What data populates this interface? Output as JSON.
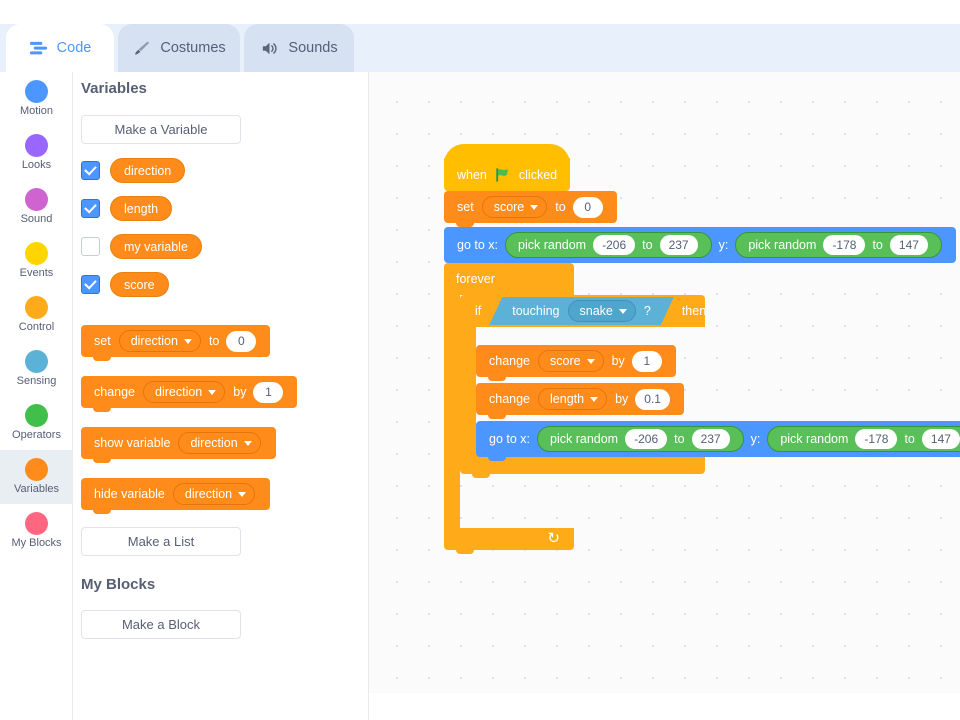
{
  "tabs": [
    {
      "id": "code",
      "label": "Code",
      "icon": "code-icon",
      "active": true
    },
    {
      "id": "costumes",
      "label": "Costumes",
      "icon": "brush-icon",
      "active": false
    },
    {
      "id": "sounds",
      "label": "Sounds",
      "icon": "speaker-icon",
      "active": false
    }
  ],
  "categories": [
    {
      "label": "Motion",
      "color": "#4c97ff",
      "selected": false
    },
    {
      "label": "Looks",
      "color": "#9966ff",
      "selected": false
    },
    {
      "label": "Sound",
      "color": "#cf63cf",
      "selected": false
    },
    {
      "label": "Events",
      "color": "#ffd500",
      "selected": false
    },
    {
      "label": "Control",
      "color": "#ffab19",
      "selected": false
    },
    {
      "label": "Sensing",
      "color": "#5cb1d6",
      "selected": false
    },
    {
      "label": "Operators",
      "color": "#40bf4a",
      "selected": false
    },
    {
      "label": "Variables",
      "color": "#ff8c1a",
      "selected": true
    },
    {
      "label": "My Blocks",
      "color": "#ff6680",
      "selected": false
    }
  ],
  "palette": {
    "variables_heading": "Variables",
    "make_variable_button": "Make a Variable",
    "variables": [
      {
        "name": "direction",
        "checked": true
      },
      {
        "name": "length",
        "checked": true
      },
      {
        "name": "my variable",
        "checked": false
      },
      {
        "name": "score",
        "checked": true
      }
    ],
    "blocks": {
      "set_label": "set",
      "set_variable": "direction",
      "set_to_label": "to",
      "set_value": "0",
      "change_label": "change",
      "change_variable": "direction",
      "change_by_label": "by",
      "change_value": "1",
      "show_variable_label": "show variable",
      "show_variable_value": "direction",
      "hide_variable_label": "hide variable",
      "hide_variable_value": "direction"
    },
    "make_list_button": "Make a List",
    "my_blocks_heading": "My Blocks",
    "make_block_button": "Make a Block"
  },
  "script": {
    "hat": {
      "when": "when",
      "flag": "green-flag-icon",
      "clicked": "clicked"
    },
    "set_score": {
      "set": "set",
      "variable": "score",
      "to": "to",
      "value": "0"
    },
    "go_to_top": {
      "go_to_x": "go to x:",
      "x_pick_random": "pick random",
      "x_from": "-206",
      "x_to_label": "to",
      "x_to": "237",
      "y_label": "y:",
      "y_pick_random": "pick random",
      "y_from": "-178",
      "y_to_label": "to",
      "y_to": "147"
    },
    "forever": "forever",
    "if_block": {
      "if": "if",
      "touching": "touching",
      "target": "snake",
      "question": "?",
      "then": "then"
    },
    "change_score": {
      "change": "change",
      "variable": "score",
      "by": "by",
      "value": "1"
    },
    "change_length": {
      "change": "change",
      "variable": "length",
      "by": "by",
      "value": "0.1"
    },
    "go_to_inner": {
      "go_to_x": "go to x:",
      "x_pick_random": "pick random",
      "x_from": "-206",
      "x_to_label": "to",
      "x_to": "237",
      "y_label": "y:",
      "y_pick_random": "pick random",
      "y_from": "-178",
      "y_to_label": "to",
      "y_to": "147"
    },
    "loop_arrow": "↻"
  },
  "colors": {
    "variables": "#ff8c1a",
    "motion": "#4c97ff",
    "control": "#ffab19",
    "events": "#ffbf00",
    "operators": "#59c059",
    "sensing": "#5cb1d6",
    "accent": "#4c97ff"
  }
}
